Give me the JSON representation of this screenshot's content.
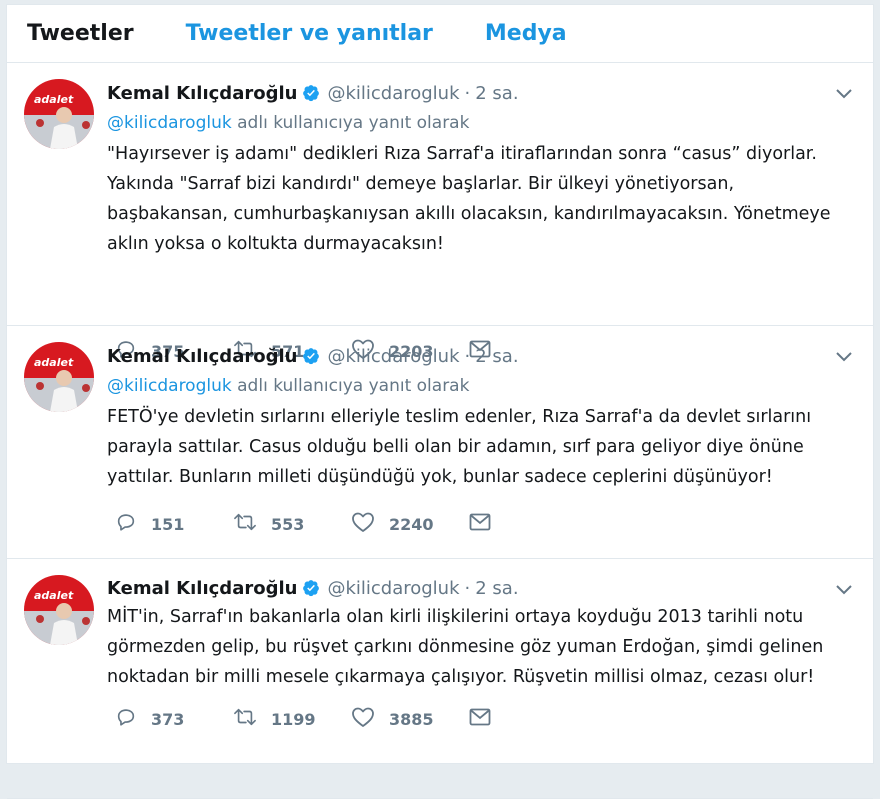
{
  "tabs": [
    "Tweetler",
    "Tweetler ve yanıtlar",
    "Medya"
  ],
  "tweets": [
    {
      "name": "Kemal Kılıçdaroğlu",
      "handle": "@kilicdarogluk",
      "dot": "·",
      "time": "2 sa.",
      "reply_handle": "@kilicdarogluk",
      "reply_rest": " adlı kullanıcıya yanıt olarak",
      "text": "\"Hayırsever iş adamı\" dedikleri Rıza Sarraf'a itiraflarından sonra “casus” diyorlar. Yakında \"Sarraf bizi kandırdı\" demeye başlarlar. Bir ülkeyi yönetiyorsan, başbakansan, cumhurbaşkanıysan akıllı olacaksın, kandırılmayacaksın. Yönetmeye aklın yoksa o koltukta durmayacaksın!",
      "replies": "375",
      "retweets": "571",
      "likes": "2203"
    },
    {
      "name": "Kemal Kılıçdaroğlu",
      "handle": "@kilicdarogluk",
      "dot": "·",
      "time": "2 sa.",
      "reply_handle": "@kilicdarogluk",
      "reply_rest": " adlı kullanıcıya yanıt olarak",
      "text": "FETÖ'ye devletin sırlarını elleriyle teslim edenler, Rıza Sarraf'a da devlet sırlarını parayla sattılar. Casus olduğu belli olan bir adamın, sırf para geliyor diye önüne yattılar. Bunların milleti düşündüğü yok, bunlar sadece ceplerini düşünüyor!",
      "replies": "151",
      "retweets": "553",
      "likes": "2240"
    },
    {
      "name": "Kemal Kılıçdaroğlu",
      "handle": "@kilicdarogluk",
      "dot": "·",
      "time": "2 sa.",
      "text": "MİT'in, Sarraf'ın bakanlarla olan kirli ilişkilerini ortaya koyduğu 2013 tarihli notu görmezden gelip, bu rüşvet çarkını dönmesine göz yuman Erdoğan, şimdi gelinen noktadan bir milli mesele çıkarmaya çalışıyor. Rüşvetin millisi olmaz, cezası olur!",
      "replies": "373",
      "retweets": "1199",
      "likes": "3885"
    }
  ],
  "colors": {
    "accent": "#1b95e0",
    "muted": "#657786",
    "text": "#14171a",
    "border": "#e1e8ed",
    "avatar_red": "#d71920"
  },
  "icons": [
    "verified-icon",
    "chevron-down-icon",
    "reply-icon",
    "retweet-icon",
    "like-icon",
    "message-icon"
  ]
}
